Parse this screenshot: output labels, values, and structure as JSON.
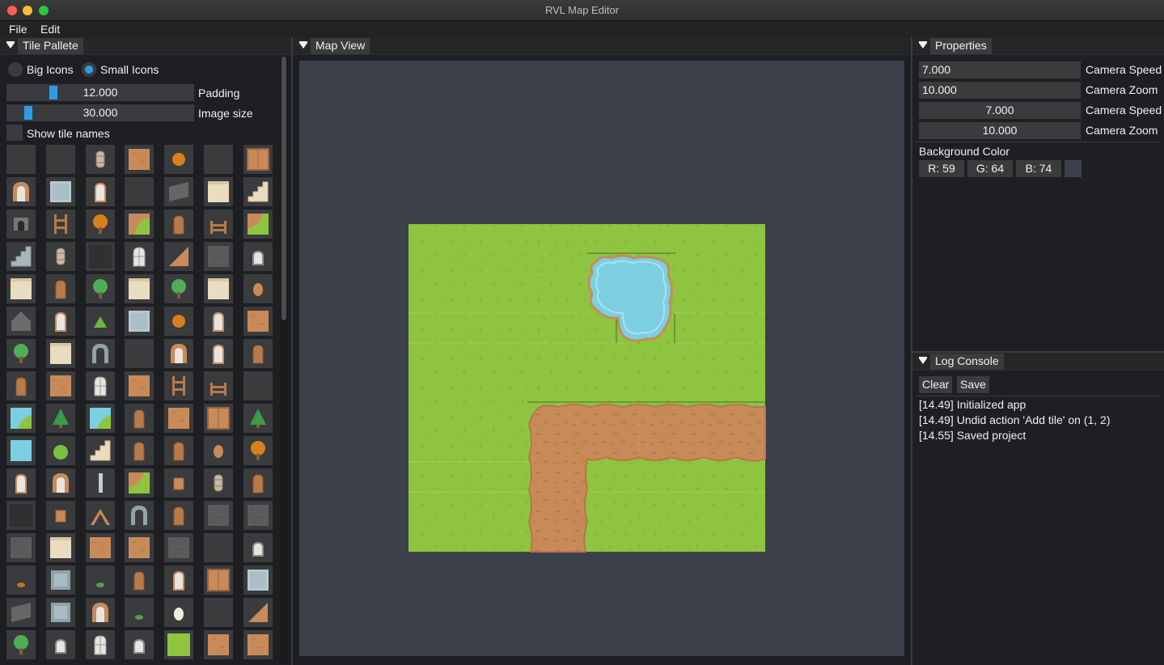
{
  "window": {
    "title": "RVL Map Editor"
  },
  "menu": [
    {
      "label": "File"
    },
    {
      "label": "Edit"
    }
  ],
  "tile_palette": {
    "title": "Tile Pallete",
    "radio_big": "Big Icons",
    "radio_small": "Small Icons",
    "selected_radio": "Small Icons",
    "padding_value": "12.000",
    "padding_label": "Padding",
    "padding_fraction": 0.24,
    "image_size_value": "30.000",
    "image_size_label": "Image size",
    "image_size_fraction": 0.1,
    "show_tile_names_label": "Show tile names",
    "show_tile_names_checked": false,
    "tile_icons": [
      "blank-tile",
      "blank-tile",
      "barrel-icon",
      "dirt-tile",
      "orange-bush-icon",
      "blank-tile",
      "crate-tile",
      "arch-door-icon",
      "water-stone-tile",
      "arch-window-icon",
      "blank-tile",
      "stone-slope-tile",
      "sand-tile",
      "stairs-tile",
      "stone-doorway-icon",
      "ladder-icon",
      "orange-tree-icon",
      "grass-dirt-corner-tile",
      "wood-door-icon",
      "fence-icon",
      "dirt-grass-tile",
      "stone-stairs-tile",
      "barrel-icon",
      "dark-tile",
      "window-icon",
      "dirt-diagonal-tile",
      "stone-tile",
      "arch-icon",
      "sand-tile",
      "wood-door-icon",
      "green-tree-icon",
      "sand-tile",
      "green-tree-icon",
      "sand-tile",
      "pot-icon",
      "roof-icon",
      "arch-window-icon",
      "small-bush-icon",
      "water-stone-tile",
      "orange-bush-icon",
      "arch-window-icon",
      "dirt-tile",
      "green-tree-icon",
      "sand-tile",
      "stone-arch-icon",
      "blank-tile",
      "arch-door-icon",
      "arch-window-icon",
      "wood-door-icon",
      "wood-door-icon",
      "dirt-tile",
      "window-icon",
      "dirt-tile",
      "ladder-icon",
      "fence-icon",
      "blank-tile",
      "water-edge-tile",
      "pine-icon",
      "water-edge-tile",
      "wood-door-icon",
      "dirt-tile",
      "crate-tile",
      "pine-icon",
      "water-tile",
      "round-bush-icon",
      "stairs-tile",
      "wood-door-icon",
      "wood-door-icon",
      "pot-icon",
      "orange-tree-icon",
      "arch-window-icon",
      "arch-door-icon",
      "pillar-icon",
      "dirt-grass-tile",
      "box-icon",
      "barrel-icon",
      "wood-door-icon",
      "dark-tile",
      "box-icon",
      "roof-peak-icon",
      "stone-arch-icon",
      "wood-door-icon",
      "stone-tile",
      "stone-tile",
      "stone-tile",
      "sand-tile",
      "dirt-tile",
      "dirt-tile",
      "stone-tile",
      "blank-tile",
      "arch-icon",
      "orange-leaf-icon",
      "stone-block-tile",
      "leaf-icon",
      "wood-door-icon",
      "arch-window-icon",
      "crate-tile",
      "water-stone-tile",
      "stone-slope-tile",
      "stone-block-tile",
      "arch-door-icon",
      "leaf-icon",
      "egg-icon",
      "blank-tile",
      "dirt-diagonal-tile",
      "green-tree-icon",
      "arch-icon",
      "window-icon",
      "arch-icon",
      "grass-tile",
      "dirt-tile",
      "dirt-tile"
    ]
  },
  "map_view": {
    "title": "Map View",
    "colors": {
      "grass": "#8ec440",
      "water": "#7ccfe0",
      "dirt": "#c98a5a",
      "background": "#3b404a"
    }
  },
  "properties": {
    "title": "Properties",
    "rows": [
      {
        "value": "7.000",
        "label": "Camera Speed",
        "align": "left"
      },
      {
        "value": "10.000",
        "label": "Camera Zoom",
        "align": "left"
      },
      {
        "value": "7.000",
        "label": "Camera Speed",
        "align": "center"
      },
      {
        "value": "10.000",
        "label": "Camera Zoom",
        "align": "center"
      }
    ],
    "background_color_label": "Background Color",
    "r": "R: 59",
    "g": "G: 64",
    "b": "B: 74",
    "swatch": "#3b404a"
  },
  "log_console": {
    "title": "Log Console",
    "clear_label": "Clear",
    "save_label": "Save",
    "lines": [
      "[14.49] Initialized app",
      "[14.49] Undid action 'Add tile' on (1, 2)",
      "[14.55] Saved project"
    ]
  }
}
